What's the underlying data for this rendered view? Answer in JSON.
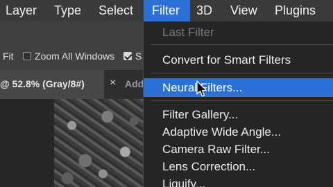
{
  "menubar": {
    "items": [
      {
        "label": "Layer"
      },
      {
        "label": "Type"
      },
      {
        "label": "Select"
      },
      {
        "label": "Filter"
      },
      {
        "label": "3D"
      },
      {
        "label": "View"
      },
      {
        "label": "Plugins"
      }
    ],
    "active": "Filter"
  },
  "options_bar": {
    "fit_label": "Fit",
    "zoom_all_windows": {
      "label": "Zoom All Windows",
      "checked": false
    },
    "scrubby": {
      "label": "S",
      "checked": true
    }
  },
  "tabs": {
    "active_label": "@ 52.8% (Gray/8#)",
    "close_glyph": "×",
    "next_label": "Add"
  },
  "filter_menu": {
    "last_filter": "Last Filter",
    "convert_smart": "Convert for Smart Filters",
    "neural_filters": "Neural Filters...",
    "filter_gallery": "Filter Gallery...",
    "adaptive_wide_angle": "Adaptive Wide Angle...",
    "camera_raw": "Camera Raw Filter...",
    "lens_correction": "Lens Correction...",
    "liquify": "Liquify..."
  },
  "colors": {
    "menu_bg": "#3a3a3a",
    "highlight": "#2c6fd6",
    "dropdown_bg": "#252525"
  }
}
